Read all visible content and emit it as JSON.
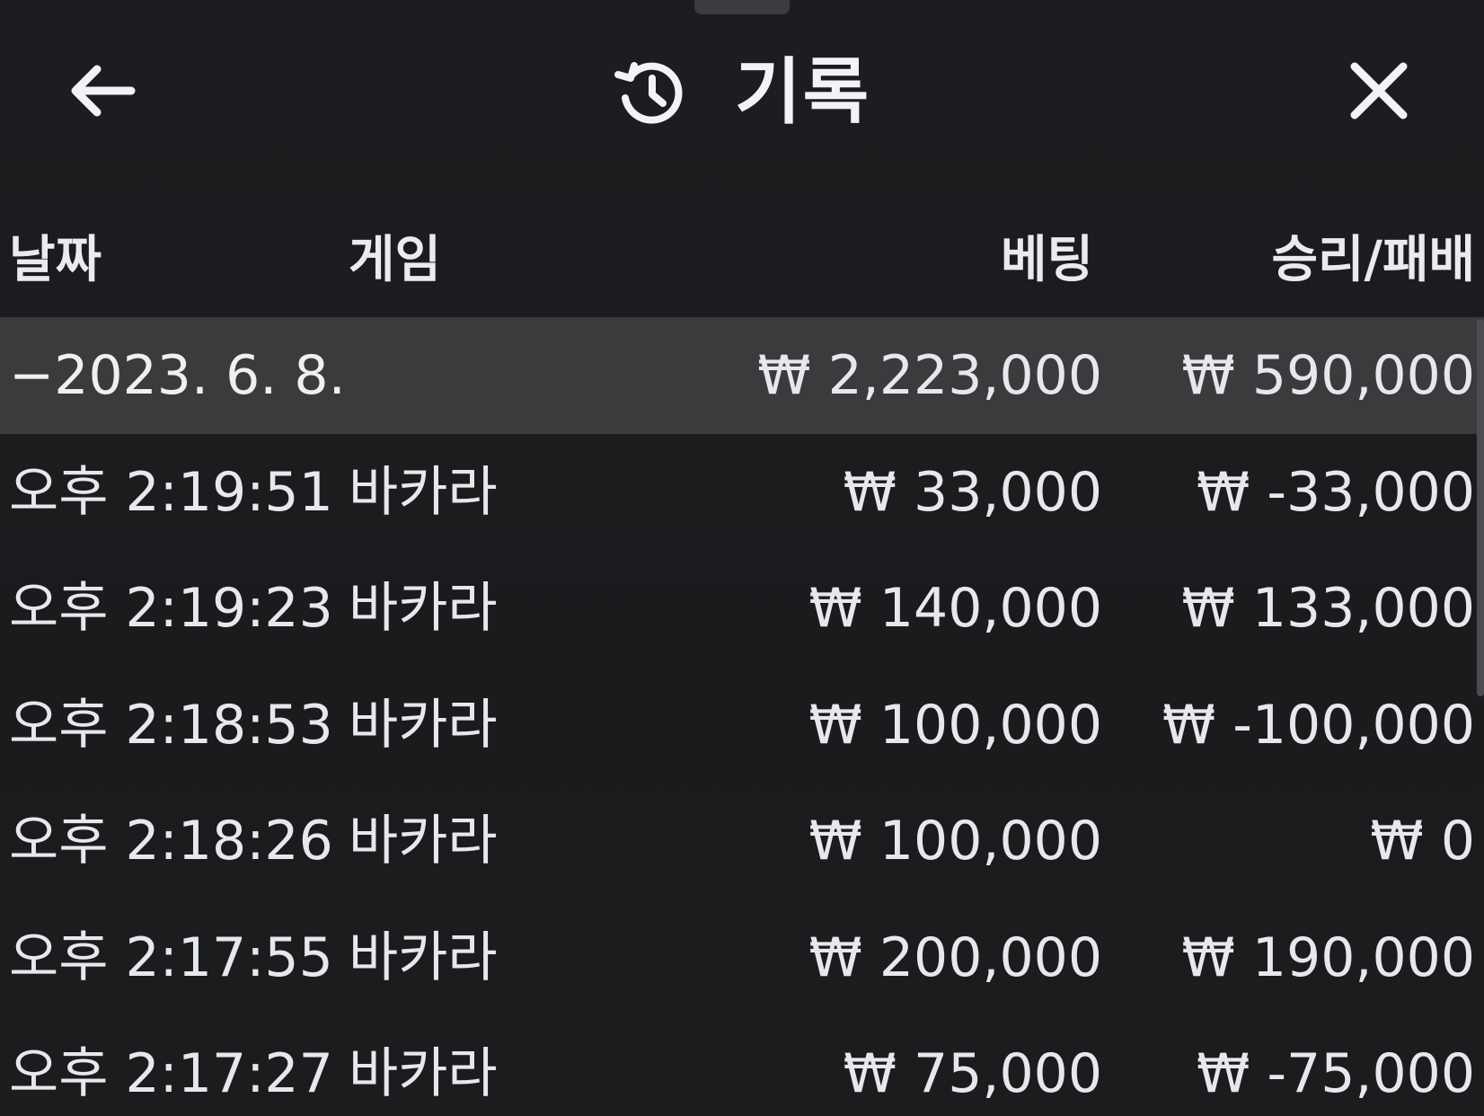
{
  "header": {
    "title": "기록",
    "back_icon": "arrow-left-icon",
    "history_icon": "history-icon",
    "close_icon": "close-icon"
  },
  "table": {
    "columns": {
      "date": "날짜",
      "game": "게임",
      "bet": "베팅",
      "result": "승리/패배"
    },
    "date_group": {
      "date": "−2023. 6. 8.",
      "bet_total": "₩ 2,223,000",
      "result_total": "₩ 590,000"
    },
    "rows": [
      {
        "time": "오후 2:19:51",
        "game": "바카라",
        "bet": "₩ 33,000",
        "result": "₩ -33,000"
      },
      {
        "time": "오후 2:19:23",
        "game": "바카라",
        "bet": "₩ 140,000",
        "result": "₩ 133,000"
      },
      {
        "time": "오후 2:18:53",
        "game": "바카라",
        "bet": "₩ 100,000",
        "result": "₩ -100,000"
      },
      {
        "time": "오후 2:18:26",
        "game": "바카라",
        "bet": "₩ 100,000",
        "result": "₩ 0"
      },
      {
        "time": "오후 2:17:55",
        "game": "바카라",
        "bet": "₩ 200,000",
        "result": "₩ 190,000"
      },
      {
        "time": "오후 2:17:27",
        "game": "바카라",
        "bet": "₩ 75,000",
        "result": "₩ -75,000"
      }
    ]
  }
}
